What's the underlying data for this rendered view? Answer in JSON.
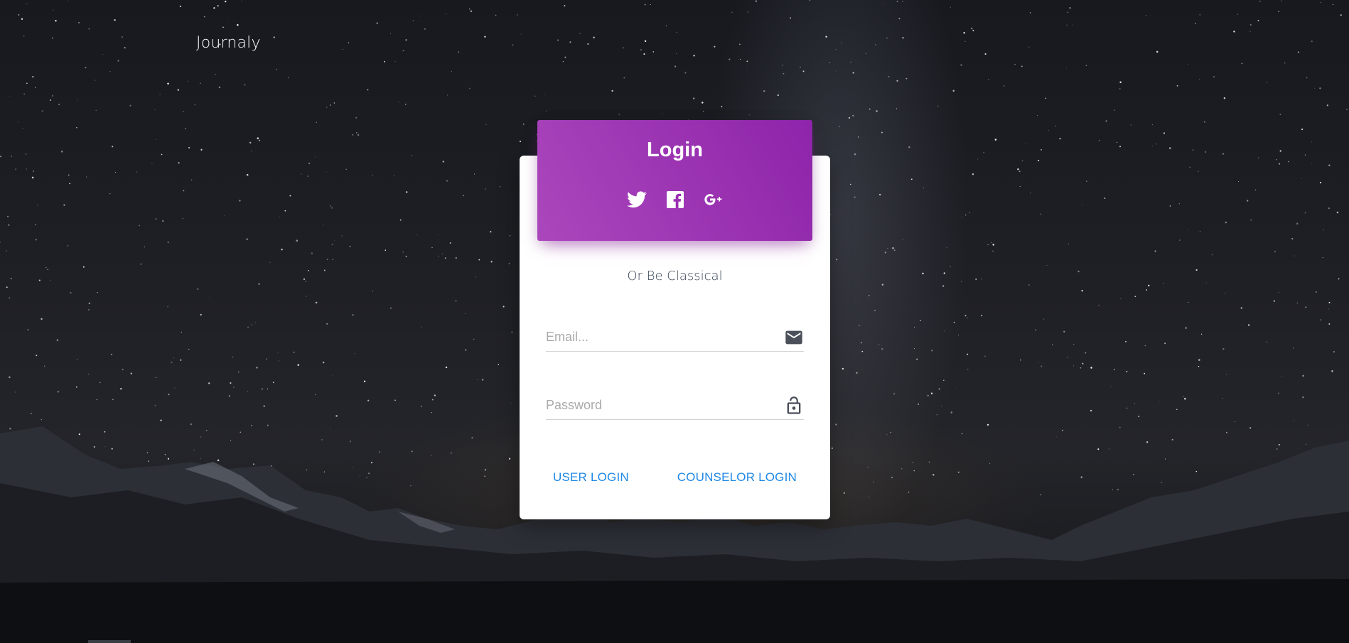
{
  "app": {
    "brand": "Journaly"
  },
  "card": {
    "title": "Login",
    "social": [
      {
        "icon": "twitter-icon"
      },
      {
        "icon": "facebook-icon"
      },
      {
        "icon": "google-plus-icon"
      }
    ],
    "divider_text": "Or Be Classical",
    "email": {
      "placeholder": "Email...",
      "value": "",
      "icon": "envelope-icon"
    },
    "password": {
      "placeholder": "Password",
      "value": "",
      "icon": "lock-icon"
    },
    "actions": {
      "user_login": "USER LOGIN",
      "counselor_login": "COUNSELOR LOGIN"
    }
  },
  "colors": {
    "header_gradient_start": "#ab47bc",
    "header_gradient_end": "#8e24aa",
    "link": "#1e88e5",
    "card_bg": "#ffffff"
  }
}
